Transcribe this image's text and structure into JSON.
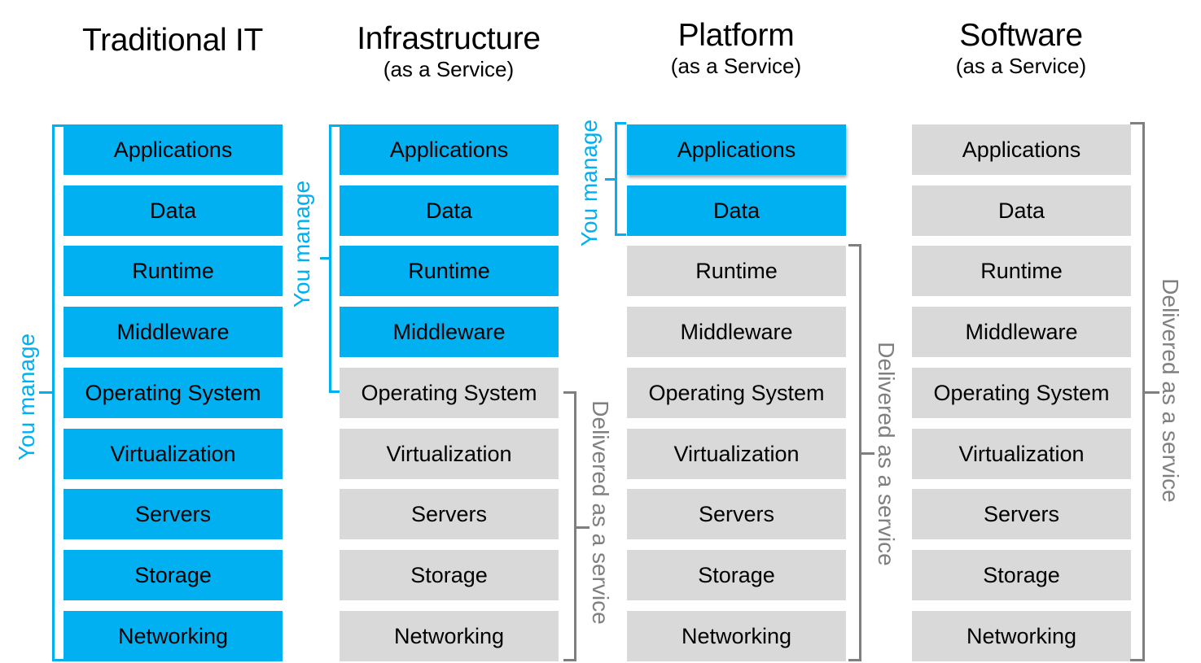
{
  "columns": [
    {
      "title": "Traditional IT",
      "subtitle": "",
      "layers": [
        {
          "label": "Applications",
          "managed_by": "you"
        },
        {
          "label": "Data",
          "managed_by": "you"
        },
        {
          "label": "Runtime",
          "managed_by": "you"
        },
        {
          "label": "Middleware",
          "managed_by": "you"
        },
        {
          "label": "Operating System",
          "managed_by": "you"
        },
        {
          "label": "Virtualization",
          "managed_by": "you"
        },
        {
          "label": "Servers",
          "managed_by": "you"
        },
        {
          "label": "Storage",
          "managed_by": "you"
        },
        {
          "label": "Networking",
          "managed_by": "you"
        }
      ],
      "you_manage_label": "You manage"
    },
    {
      "title": "Infrastructure",
      "subtitle": "(as a Service)",
      "layers": [
        {
          "label": "Applications",
          "managed_by": "you"
        },
        {
          "label": "Data",
          "managed_by": "you"
        },
        {
          "label": "Runtime",
          "managed_by": "you"
        },
        {
          "label": "Middleware",
          "managed_by": "you"
        },
        {
          "label": "Operating System",
          "managed_by": "provider"
        },
        {
          "label": "Virtualization",
          "managed_by": "provider"
        },
        {
          "label": "Servers",
          "managed_by": "provider"
        },
        {
          "label": "Storage",
          "managed_by": "provider"
        },
        {
          "label": "Networking",
          "managed_by": "provider"
        }
      ],
      "you_manage_label": "You manage",
      "delivered_label": "Delivered as a service"
    },
    {
      "title": "Platform",
      "subtitle": "(as a Service)",
      "layers": [
        {
          "label": "Applications",
          "managed_by": "you"
        },
        {
          "label": "Data",
          "managed_by": "you"
        },
        {
          "label": "Runtime",
          "managed_by": "provider"
        },
        {
          "label": "Middleware",
          "managed_by": "provider"
        },
        {
          "label": "Operating System",
          "managed_by": "provider"
        },
        {
          "label": "Virtualization",
          "managed_by": "provider"
        },
        {
          "label": "Servers",
          "managed_by": "provider"
        },
        {
          "label": "Storage",
          "managed_by": "provider"
        },
        {
          "label": "Networking",
          "managed_by": "provider"
        }
      ],
      "you_manage_label": "You manage",
      "delivered_label": "Delivered as a service"
    },
    {
      "title": "Software",
      "subtitle": "(as a Service)",
      "layers": [
        {
          "label": "Applications",
          "managed_by": "provider"
        },
        {
          "label": "Data",
          "managed_by": "provider"
        },
        {
          "label": "Runtime",
          "managed_by": "provider"
        },
        {
          "label": "Middleware",
          "managed_by": "provider"
        },
        {
          "label": "Operating System",
          "managed_by": "provider"
        },
        {
          "label": "Virtualization",
          "managed_by": "provider"
        },
        {
          "label": "Servers",
          "managed_by": "provider"
        },
        {
          "label": "Storage",
          "managed_by": "provider"
        },
        {
          "label": "Networking",
          "managed_by": "provider"
        }
      ],
      "delivered_label": "Delivered as a service"
    }
  ],
  "colors": {
    "you_manage": "#00B0F0",
    "delivered": "#D9D9D9",
    "delivered_bracket": "#7F7F7F",
    "delivered_text": "#808080"
  }
}
